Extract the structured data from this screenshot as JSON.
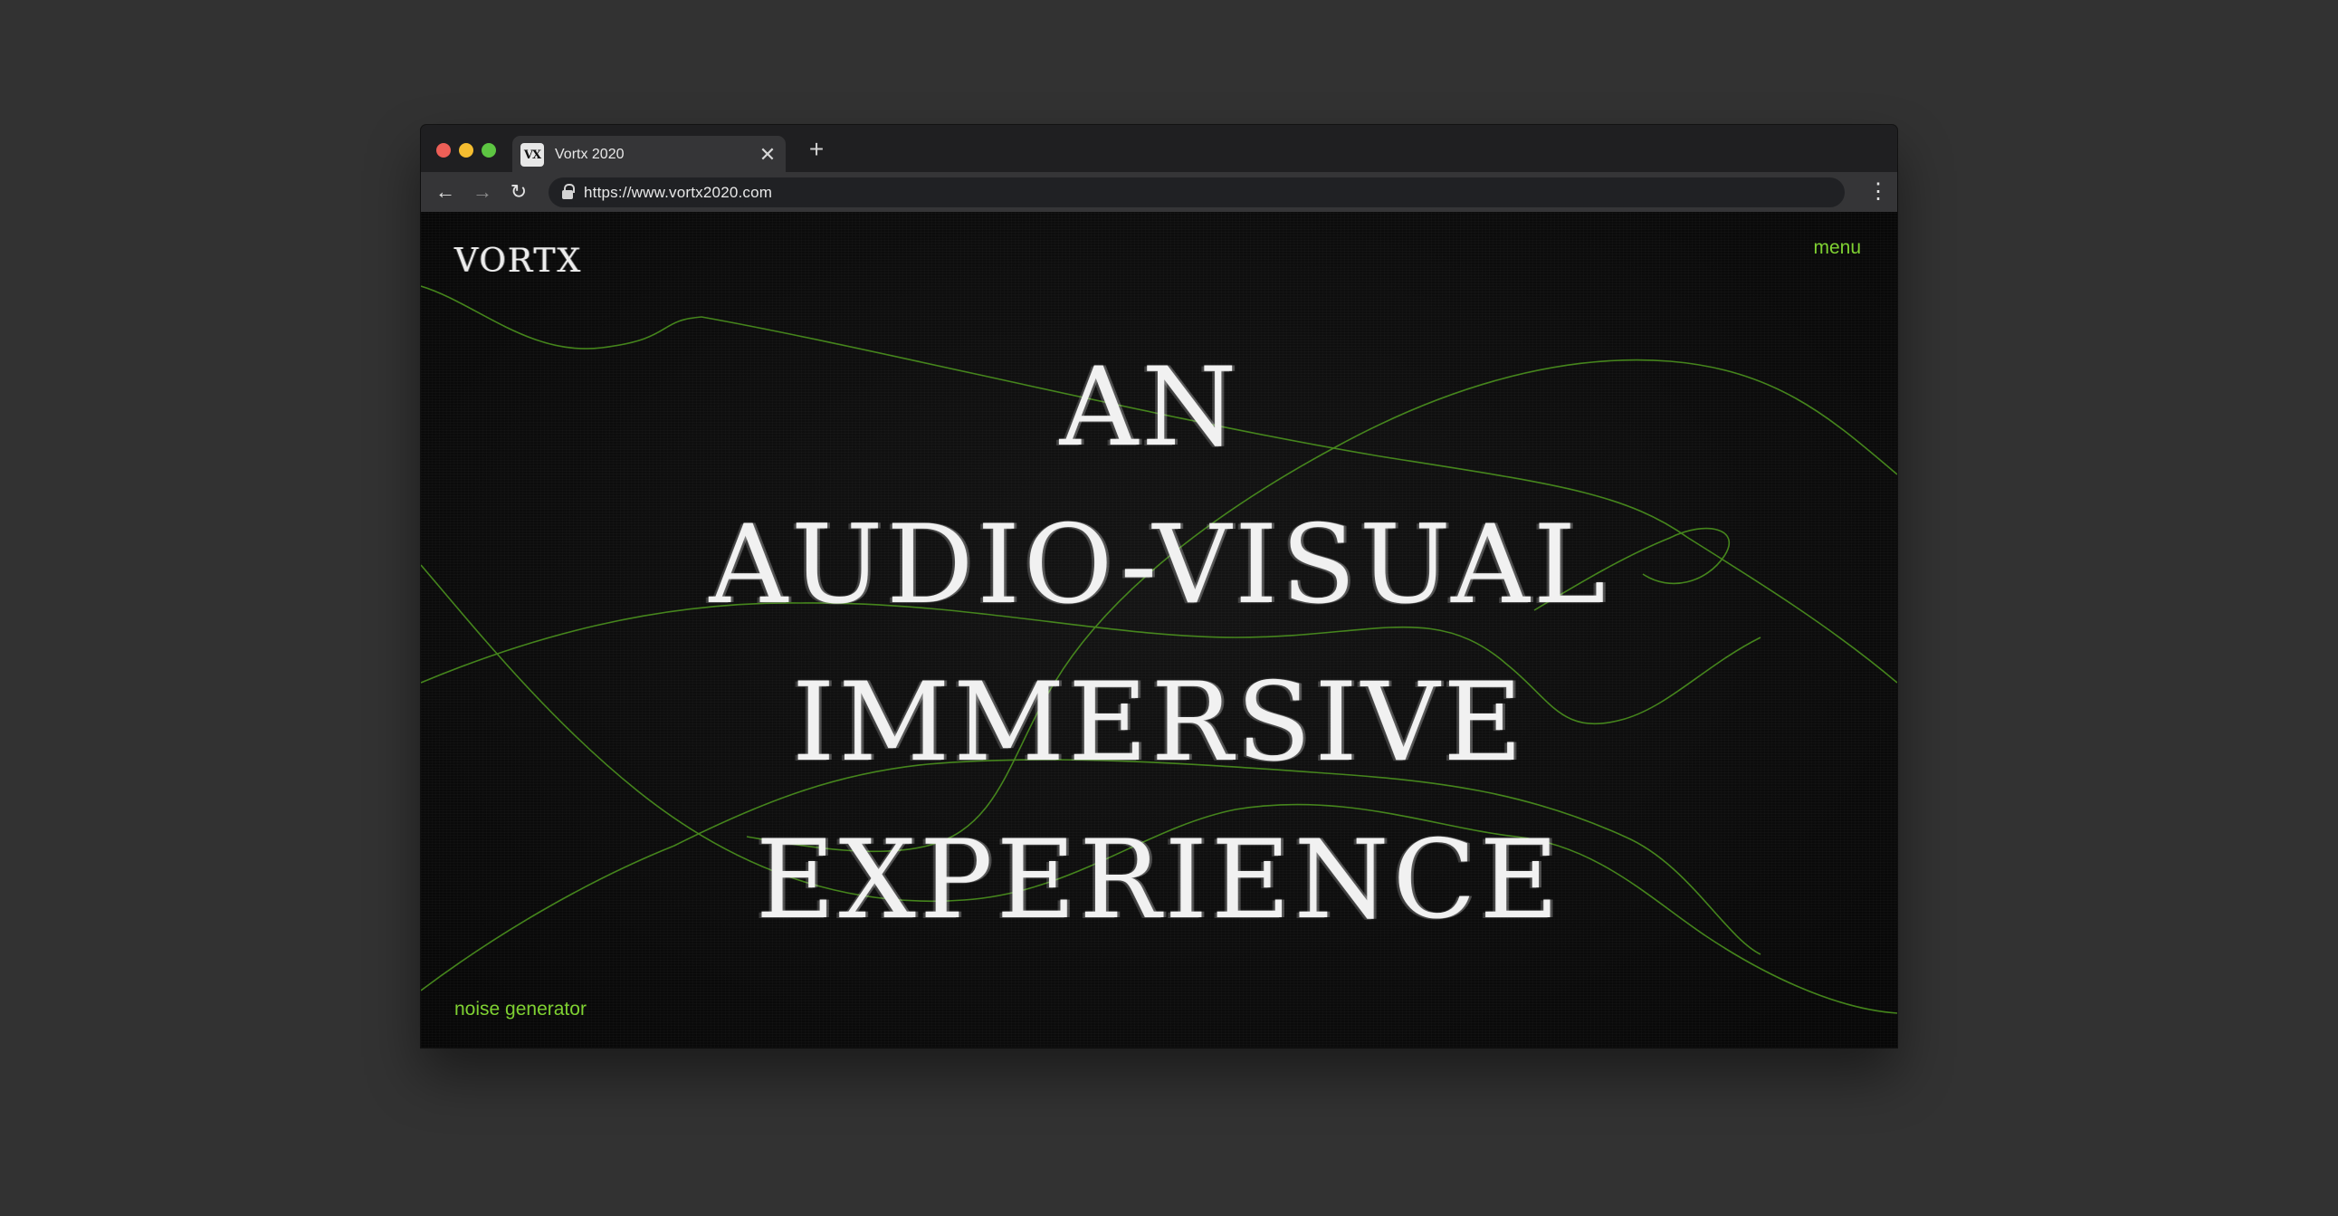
{
  "browser": {
    "tab_title": "Vortx 2020",
    "tab_favicon": "VX",
    "tab_close": "✕",
    "new_tab": "+",
    "url": "https://www.vortx2020.com",
    "back": "←",
    "forward": "→",
    "reload": "↻",
    "menu": "⋮"
  },
  "page": {
    "logo": "VORTX",
    "menu_label": "menu",
    "noise_label": "noise generator",
    "headline": [
      "AN",
      "AUDIO-VISUAL",
      "IMMERSIVE",
      "EXPERIENCE"
    ],
    "accent_color": "#7fd132"
  }
}
